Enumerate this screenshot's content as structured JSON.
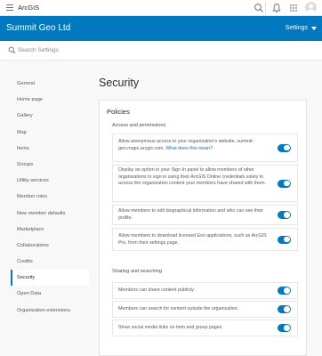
{
  "topbar": {
    "brand": "ArcGIS",
    "icons": [
      "hamburger-icon",
      "search-icon",
      "notification-bell-icon",
      "apps-grid-icon",
      "user-avatar-icon"
    ]
  },
  "header": {
    "org_name": "Summit Geo Ltd",
    "settings_label": "Settings"
  },
  "search": {
    "placeholder": "Search Settings"
  },
  "sidebar": {
    "items": [
      {
        "label": "General"
      },
      {
        "label": "Home page"
      },
      {
        "label": "Gallery"
      },
      {
        "label": "Map"
      },
      {
        "label": "Items"
      },
      {
        "label": "Groups"
      },
      {
        "label": "Utility services"
      },
      {
        "label": "Member roles"
      },
      {
        "label": "New member defaults"
      },
      {
        "label": "Marketplace"
      },
      {
        "label": "Collaborations"
      },
      {
        "label": "Credits"
      },
      {
        "label": "Security",
        "active": true
      },
      {
        "label": "Open Data"
      },
      {
        "label": "Organization extensions"
      }
    ]
  },
  "main": {
    "page_title": "Security",
    "policies": {
      "title": "Policies",
      "access": {
        "title": "Access and permissions",
        "items": [
          {
            "text": "Allow anonymous access to your organization's website, summit-geo.maps.arcgis.com.",
            "link": "What does this mean?",
            "enabled": true
          },
          {
            "text": "Display an option in your Sign In panel to allow members of other organizations to sign in using their ArcGIS Online credentials solely to access the organization content your members have shared with them.",
            "enabled": true
          },
          {
            "text": "Allow members to edit biographical information and who can see their profile.",
            "enabled": true
          },
          {
            "text": "Allow members to download licensed Esri applications, such as ArcGIS Pro, from their settings page.",
            "enabled": true
          }
        ]
      },
      "sharing": {
        "title": "Sharing and searching",
        "items": [
          {
            "text": "Members can share content publicly.",
            "enabled": true
          },
          {
            "text": "Members can search for content outside the organization.",
            "enabled": true
          },
          {
            "text": "Show social media links on item and group pages.",
            "enabled": true
          }
        ]
      }
    }
  },
  "colors": {
    "brand_blue": "#0079c1",
    "page_bg": "#f8f8f8",
    "card_bg": "#ffffff"
  }
}
